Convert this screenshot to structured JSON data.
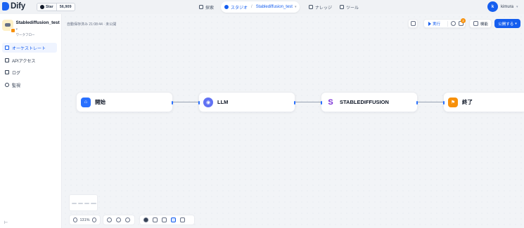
{
  "header": {
    "logo": "Dify",
    "github": {
      "label": "Star",
      "count": "56,909"
    },
    "nav": {
      "explore": "探索",
      "studio": "スタジオ",
      "current_app": "Stablediffusion_test",
      "knowledge": "ナレッジ",
      "tools": "ツール"
    },
    "user": {
      "initial": "k",
      "name": "kimura"
    }
  },
  "sidebar": {
    "app_name": "Stablediffusion_test",
    "app_type": "ワークフロー",
    "items": [
      {
        "label": "オーケストレート",
        "icon": "orchestrate-icon",
        "active": true
      },
      {
        "label": "APIアクセス",
        "icon": "api-icon",
        "active": false
      },
      {
        "label": "ログ",
        "icon": "log-icon",
        "active": false
      },
      {
        "label": "監視",
        "icon": "monitor-icon",
        "active": false
      }
    ]
  },
  "canvas": {
    "status": "自動保存済み 21:08:44 · 未公開",
    "toolbar": {
      "run": "実行",
      "badge": "2",
      "features": "機能",
      "publish": "公開する"
    },
    "nodes": [
      {
        "id": "start",
        "title": "開始",
        "color": "#2970ff",
        "icon": "home-icon"
      },
      {
        "id": "llm",
        "title": "LLM",
        "color": "#6172f3",
        "icon": "brain-icon"
      },
      {
        "id": "sd",
        "title": "STABLEDIFFUSION",
        "color": "#ffffff",
        "icon": "stablediffusion-icon"
      },
      {
        "id": "end",
        "title": "終了",
        "color": "#f79009",
        "icon": "flag-icon"
      }
    ],
    "zoom": "131%"
  }
}
